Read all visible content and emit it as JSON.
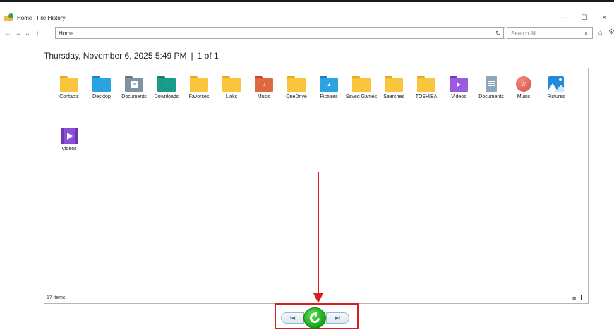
{
  "window": {
    "title": "Home - File History",
    "minimize": "—",
    "maximize": "☐",
    "close": "×"
  },
  "nav": {
    "back": "←",
    "forward": "→",
    "recent": "⌄",
    "up": "↑",
    "address": "Home",
    "search_placeholder": "Search All"
  },
  "snapshot": {
    "date": "Thursday, November 6, 2025 5:49 PM",
    "separator": "|",
    "position": "1 of 1"
  },
  "items": [
    {
      "label": "Contacts",
      "icon": "folder-icon"
    },
    {
      "label": "Desktop",
      "icon": "desktop-folder-icon"
    },
    {
      "label": "Documents",
      "icon": "documents-folder-icon"
    },
    {
      "label": "Downloads",
      "icon": "downloads-folder-icon"
    },
    {
      "label": "Favorites",
      "icon": "folder-icon"
    },
    {
      "label": "Links",
      "icon": "folder-icon"
    },
    {
      "label": "Music",
      "icon": "music-folder-icon"
    },
    {
      "label": "OneDrive",
      "icon": "folder-icon"
    },
    {
      "label": "Pictures",
      "icon": "pictures-folder-icon"
    },
    {
      "label": "Saved Games",
      "icon": "folder-icon"
    },
    {
      "label": "Searches",
      "icon": "folder-icon"
    },
    {
      "label": "TOSHIBA",
      "icon": "folder-icon"
    },
    {
      "label": "Videos",
      "icon": "videos-folder-icon"
    },
    {
      "label": "Documents",
      "icon": "documents-library-icon"
    },
    {
      "label": "Music",
      "icon": "music-library-icon"
    },
    {
      "label": "Pictures",
      "icon": "pictures-library-icon"
    },
    {
      "label": "Videos",
      "icon": "videos-library-icon"
    }
  ],
  "status": {
    "count": "17 items"
  },
  "playback": {
    "previous": "I◀",
    "next": "▶I"
  },
  "colors": {
    "annotation": "#d42020",
    "restore": "#17a317"
  }
}
